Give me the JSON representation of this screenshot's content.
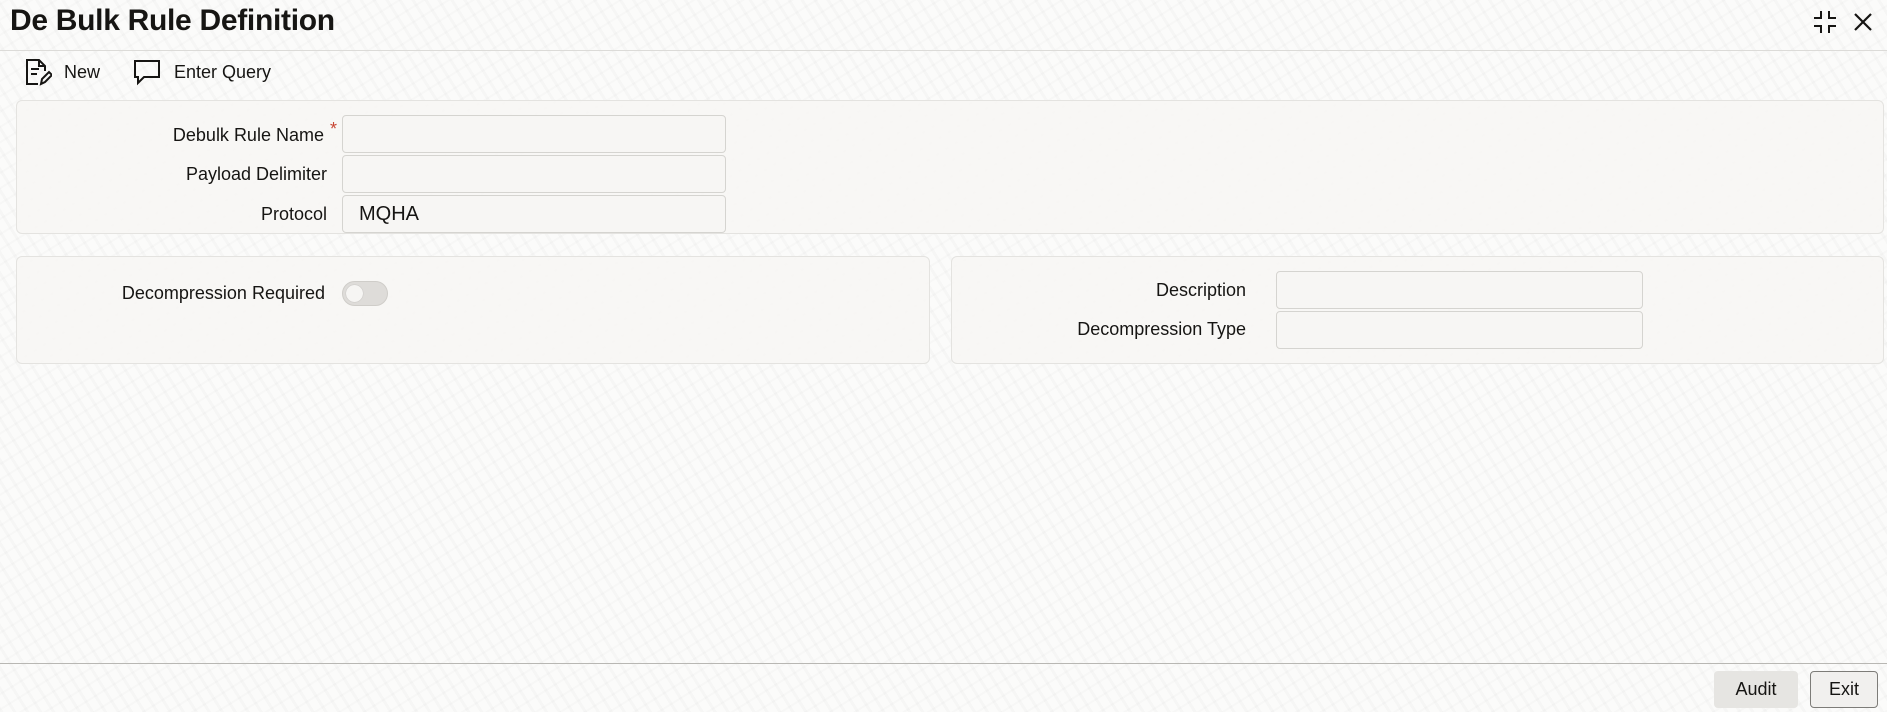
{
  "window": {
    "title": "De Bulk Rule Definition",
    "icons": [
      "collapse-icon",
      "close-icon"
    ]
  },
  "toolbar": {
    "new_label": "New",
    "enter_query_label": "Enter Query"
  },
  "header_section": {
    "debulk_rule_name": {
      "label": "Debulk Rule Name",
      "required_mark": "*",
      "value": ""
    },
    "payload_delimiter": {
      "label": "Payload Delimiter",
      "value": ""
    },
    "protocol": {
      "label": "Protocol",
      "value": "MQHA"
    }
  },
  "left_section": {
    "decompression_required": {
      "label": "Decompression Required",
      "value": false
    }
  },
  "right_section": {
    "description": {
      "label": "Description",
      "value": ""
    },
    "decompression_type": {
      "label": "Decompression Type",
      "value": ""
    }
  },
  "footer": {
    "audit_label": "Audit",
    "exit_label": "Exit"
  },
  "colors": {
    "required": "#c74634",
    "text": "#161513",
    "panel": "#f7f6f4"
  }
}
